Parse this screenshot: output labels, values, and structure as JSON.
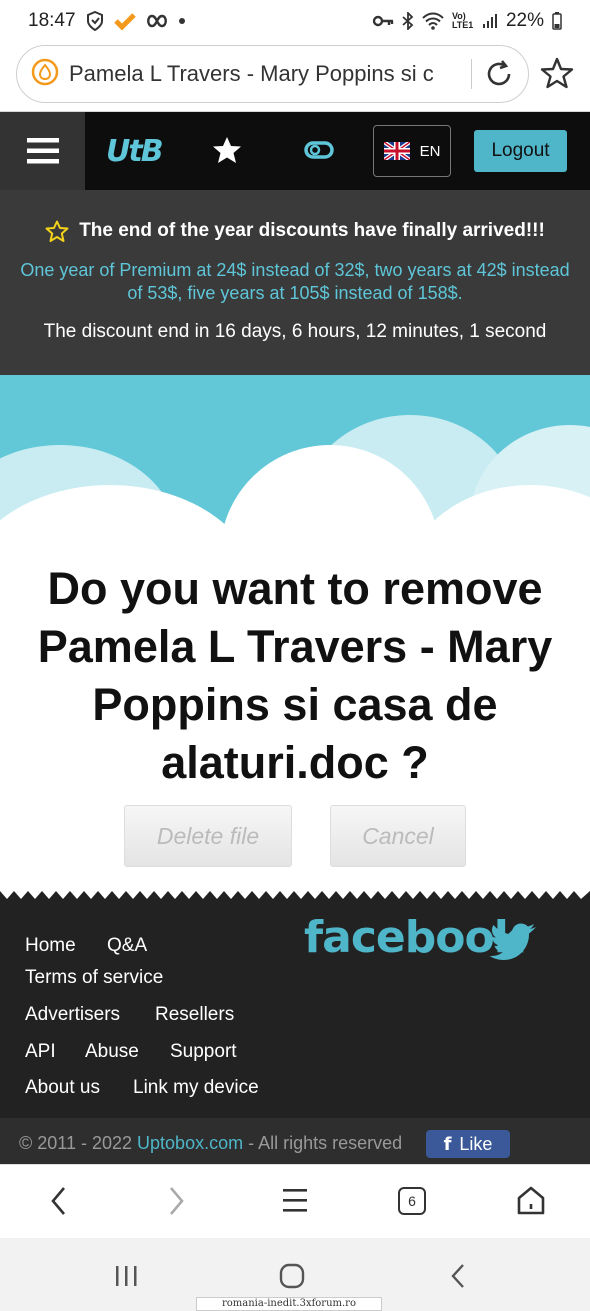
{
  "status_bar": {
    "time": "18:47",
    "network": "Vo) LTE1",
    "battery": "22%"
  },
  "url_bar": {
    "text": "Pamela L Travers - Mary Poppins si c"
  },
  "header": {
    "logo": "UtB",
    "language": "EN",
    "logout_label": "Logout",
    "accent_color": "#4fb5c8"
  },
  "promo": {
    "title": "The end of the year discounts have finally arrived!!!",
    "offer": "One year of Premium at 24$ instead of 32$, two years at 42$ instead of 53$, five years at 105$ instead of 158$.",
    "countdown": "The discount end in 16 days, 6 hours, 12 minutes, 1 second"
  },
  "main": {
    "question": "Do you want to remove Pamela L Travers - Mary Poppins si casa de alaturi.doc ?",
    "delete_label": "Delete file",
    "cancel_label": "Cancel"
  },
  "footer": {
    "links": {
      "home": "Home",
      "qa": "Q&A",
      "terms": "Terms of service",
      "advertisers": "Advertisers",
      "resellers": "Resellers",
      "api": "API",
      "abuse": "Abuse",
      "support": "Support",
      "about": "About us",
      "link_device": "Link my device"
    },
    "facebook": "facebook",
    "copyright_prefix": "© 2011 - 2022",
    "copyright_brand": "Uptobox.com",
    "copyright_suffix": "- All rights reserved",
    "like_label": "Like"
  },
  "browser_nav": {
    "tab_count": "6"
  },
  "watermark": "romania-inedit.3xforum.ro"
}
